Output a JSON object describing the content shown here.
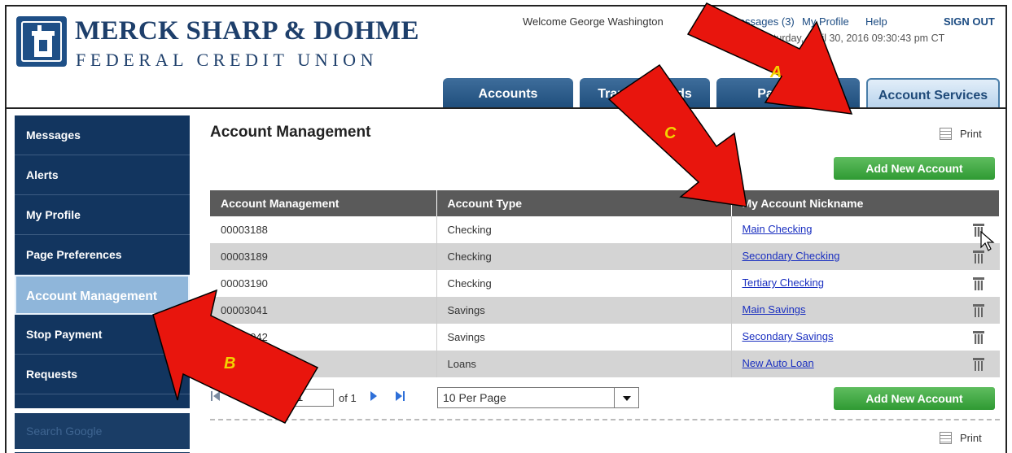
{
  "header": {
    "org_name": "MERCK SHARP & DOHME",
    "org_subtitle": "FEDERAL CREDIT UNION",
    "welcome": "Welcome George Washington",
    "messages_link": "Messages (3)",
    "profile_link": "My Profile",
    "help_link": "Help",
    "signout_link": "SIGN OUT",
    "last_login": "Last Login: Saturday, April 30, 2016 09:30:43 pm CT"
  },
  "tabs": [
    {
      "label": "Accounts"
    },
    {
      "label": "Transfer Funds"
    },
    {
      "label": "Payments"
    },
    {
      "label": "Account Services"
    }
  ],
  "sidebar": {
    "items": [
      {
        "label": "Messages"
      },
      {
        "label": "Alerts"
      },
      {
        "label": "My Profile"
      },
      {
        "label": "Page Preferences"
      },
      {
        "label": "Account Management"
      },
      {
        "label": "Stop Payment"
      },
      {
        "label": "Requests"
      }
    ],
    "active_index": 4,
    "search_placeholder": "Search Google"
  },
  "main": {
    "title": "Account Management",
    "print_label": "Print",
    "add_button": "Add New Account",
    "columns": [
      "Account Management",
      "Account Type",
      "My Account Nickname"
    ],
    "rows": [
      {
        "number": "00003188",
        "type": "Checking",
        "nickname": "Main Checking"
      },
      {
        "number": "00003189",
        "type": "Checking",
        "nickname": "Secondary Checking"
      },
      {
        "number": "00003190",
        "type": "Checking",
        "nickname": "Tertiary Checking"
      },
      {
        "number": "00003041",
        "type": "Savings",
        "nickname": "Main Savings"
      },
      {
        "number": "00003042",
        "type": "Savings",
        "nickname": "Secondary Savings"
      },
      {
        "number": "",
        "type": "Loans",
        "nickname": "New Auto Loan"
      }
    ],
    "pager": {
      "page": "1",
      "of_text": "of 1",
      "per_page": "10 Per Page"
    }
  },
  "annotations": {
    "a": "A",
    "b": "B",
    "c": "C",
    "arrow_color": "#e8150d",
    "label_color": "#f3d200"
  },
  "colors": {
    "navy": "#12355f",
    "tab_blue": "#1f4e7c",
    "green": "#2f9a33",
    "link": "#1a2fc0"
  }
}
